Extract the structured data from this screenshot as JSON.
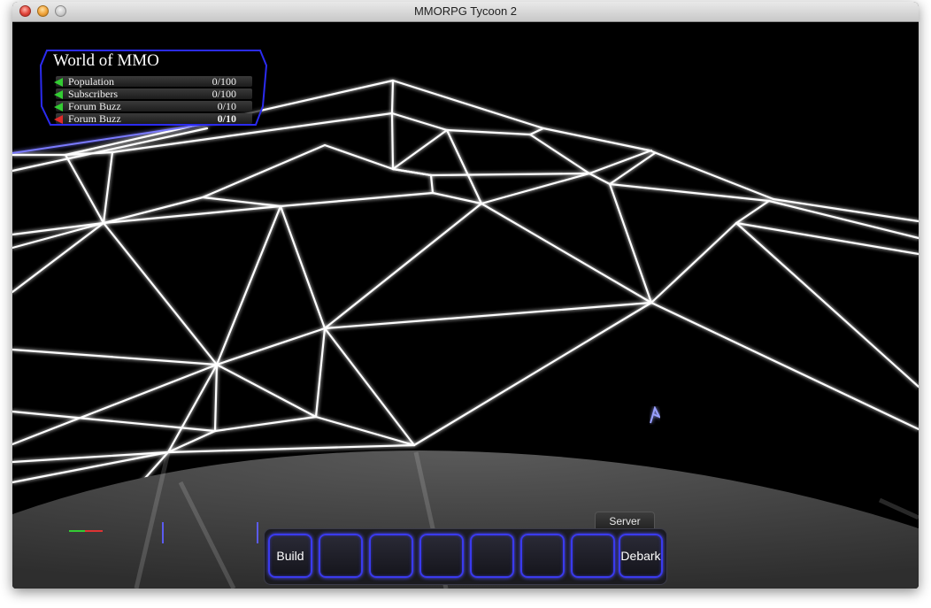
{
  "window": {
    "title": "MMORPG Tycoon 2"
  },
  "hud": {
    "world_name": "World of MMO",
    "stats": [
      {
        "label": "Population",
        "value": "0/100",
        "indicator": "green",
        "bold": false
      },
      {
        "label": "Subscribers",
        "value": "0/100",
        "indicator": "green",
        "bold": false
      },
      {
        "label": "Forum Buzz",
        "value": "0/10",
        "indicator": "green",
        "bold": false
      },
      {
        "label": "Forum Buzz",
        "value": "0/10",
        "indicator": "red",
        "bold": true
      }
    ]
  },
  "toolbar": {
    "tab_label": "Server",
    "slots": [
      "Build",
      "",
      "",
      "",
      "",
      "",
      "",
      "Debark"
    ]
  },
  "colors": {
    "wireframe": "#ffffff",
    "hud_border": "#2b2bf0",
    "slot_border": "#3a3aee",
    "indicator_green": "#33cc33",
    "indicator_red": "#e02a2a"
  }
}
